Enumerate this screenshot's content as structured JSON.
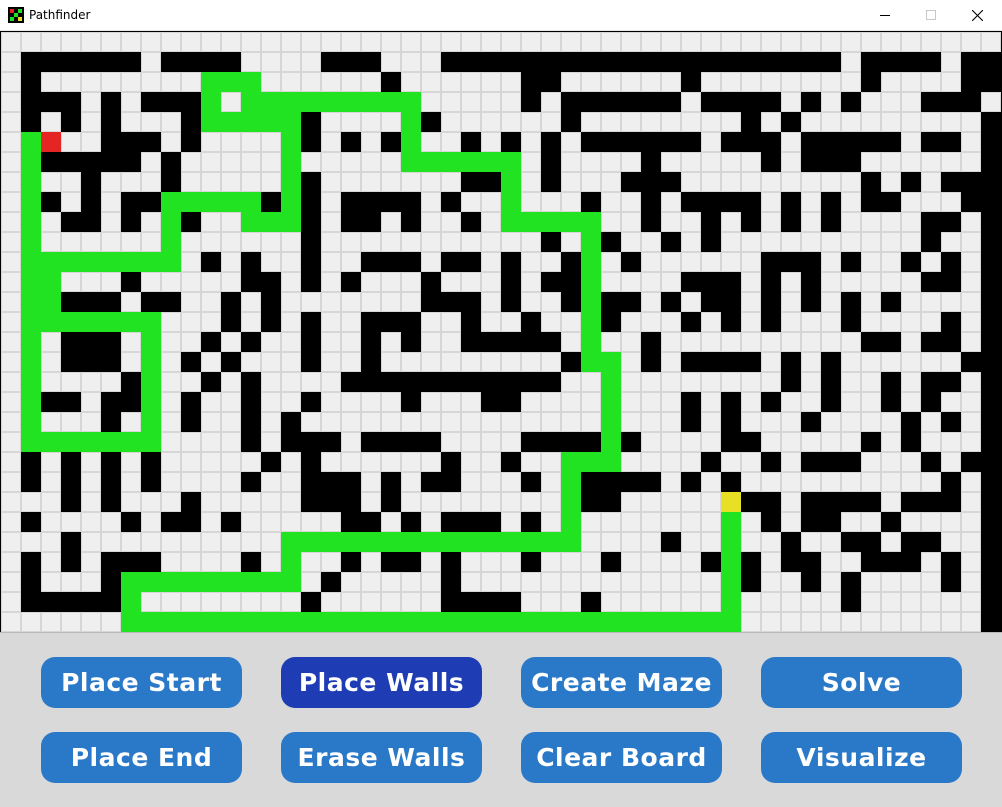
{
  "window": {
    "title": "Pathfinder"
  },
  "colors": {
    "wall": "#000000",
    "open": "#efefef",
    "gridline": "#d6d6d6",
    "path": "#22e322",
    "start": "#e52424",
    "end": "#e8e024",
    "button": "#2a78c8",
    "button_active": "#1e3cb4",
    "panel": "#d9d9d9"
  },
  "maze": {
    "cell_columns": 50,
    "cell_rows": 30,
    "open_rows": [
      "..................................................",
      ".######.####....###...####################.####.##",
      ".#.................#......##......#........#....##",
      ".###.#.###...#.###........#.######.####.#.#...###.",
      ".#.#.#...#.#...#.....#......#........#.#.........#",
      ".#...###.#.....#.#.#...#.#.#.######.###.#####.##.#",
      ".######.#...........#....#.#....#.....#.###......#",
      "....#...#......#.......###.#...###.........#.#.###",
      ".##.#.##..#.##.#.####.#......#..#.####.#.#.##...##",
      ".#.##.#.##.....#.##.#..#.##..#..#..#.#.#.#....##.#",
      ".#......#......#...........#.##..#.#..........#..#",
      ".#.####.#.#.#..#..###.##.#..#..#......###.#..#.#.#",
      "......#.....##.#.#...#...#.##.....###.#.#.....##.#",
      ".#####.##..#.#.......###.#..#.##.#.##.#.#.#.#....#",
      ".#.....#...#.#.#..###..#..#...#...#.#.#...#....#.#",
      ".#.###.#..#.#..#..#.#..#####.#..#..........##.##.#",
      "...###.#.#.#...#..#.........#...#.####.#.#......#",
      ".#....#...#.#....###########...........#.#..#.##.",
      ".###.##..#..#..#....#...##........#.#.#..#..#.#..",
      ".#...#.#.#..#.#...................#.#...#....#.#.",
      "...#...#....#.###.####....######....##.....#.#...",
      ".#.#.#.#.....#.#......#..#.........#..#.###...#.#",
      ".#.#.#.#....#..###.#.##...#.#####.#.#..........#.",
      "...#.#...#.....###.#........###......##.####.###.",
      ".#....#.##.#.....##.#.###.#.........#.#.##..#....",
      "...#..............#.....#........#.....#..##.##..",
      ".#.#.###....#....#.##.#...#...#....#.#.##..###.#.",
      ".#...#...#......#.....#..............#..#.#....#.",
      ".#####.........#......####...#............#......",
      "......................#.........................."
    ],
    "path_cells": [
      [
        2,
        5
      ],
      [
        1,
        5
      ],
      [
        1,
        6
      ],
      [
        1,
        7
      ],
      [
        1,
        8
      ],
      [
        1,
        9
      ],
      [
        1,
        10
      ],
      [
        1,
        11
      ],
      [
        1,
        12
      ],
      [
        1,
        13
      ],
      [
        1,
        14
      ],
      [
        1,
        15
      ],
      [
        1,
        16
      ],
      [
        1,
        17
      ],
      [
        1,
        18
      ],
      [
        1,
        19
      ],
      [
        1,
        20
      ],
      [
        2,
        20
      ],
      [
        3,
        20
      ],
      [
        4,
        20
      ],
      [
        5,
        20
      ],
      [
        6,
        20
      ],
      [
        7,
        20
      ],
      [
        7,
        19
      ],
      [
        7,
        18
      ],
      [
        7,
        17
      ],
      [
        7,
        16
      ],
      [
        7,
        15
      ],
      [
        7,
        14
      ],
      [
        6,
        14
      ],
      [
        5,
        14
      ],
      [
        4,
        14
      ],
      [
        3,
        14
      ],
      [
        2,
        14
      ],
      [
        2,
        13
      ],
      [
        2,
        12
      ],
      [
        2,
        11
      ],
      [
        3,
        11
      ],
      [
        4,
        11
      ],
      [
        5,
        11
      ],
      [
        6,
        11
      ],
      [
        7,
        11
      ],
      [
        8,
        11
      ],
      [
        8,
        10
      ],
      [
        8,
        9
      ],
      [
        8,
        8
      ],
      [
        9,
        8
      ],
      [
        10,
        8
      ],
      [
        11,
        8
      ],
      [
        12,
        8
      ],
      [
        12,
        9
      ],
      [
        13,
        9
      ],
      [
        14,
        9
      ],
      [
        14,
        8
      ],
      [
        14,
        7
      ],
      [
        14,
        6
      ],
      [
        14,
        5
      ],
      [
        14,
        4
      ],
      [
        13,
        4
      ],
      [
        12,
        4
      ],
      [
        11,
        4
      ],
      [
        10,
        4
      ],
      [
        10,
        3
      ],
      [
        10,
        2
      ],
      [
        11,
        2
      ],
      [
        12,
        2
      ],
      [
        12,
        3
      ],
      [
        13,
        3
      ],
      [
        14,
        3
      ],
      [
        15,
        3
      ],
      [
        16,
        3
      ],
      [
        17,
        3
      ],
      [
        18,
        3
      ],
      [
        19,
        3
      ],
      [
        20,
        3
      ],
      [
        20,
        4
      ],
      [
        20,
        5
      ],
      [
        20,
        6
      ],
      [
        21,
        6
      ],
      [
        22,
        6
      ],
      [
        23,
        6
      ],
      [
        24,
        6
      ],
      [
        25,
        6
      ],
      [
        25,
        7
      ],
      [
        25,
        8
      ],
      [
        25,
        9
      ],
      [
        26,
        9
      ],
      [
        27,
        9
      ],
      [
        28,
        9
      ],
      [
        29,
        9
      ],
      [
        29,
        10
      ],
      [
        29,
        11
      ],
      [
        29,
        12
      ],
      [
        29,
        13
      ],
      [
        29,
        14
      ],
      [
        29,
        15
      ],
      [
        29,
        16
      ],
      [
        30,
        16
      ],
      [
        30,
        17
      ],
      [
        30,
        18
      ],
      [
        30,
        19
      ],
      [
        30,
        20
      ],
      [
        30,
        21
      ],
      [
        29,
        21
      ],
      [
        28,
        21
      ],
      [
        28,
        22
      ],
      [
        28,
        23
      ],
      [
        28,
        24
      ],
      [
        28,
        25
      ],
      [
        27,
        25
      ],
      [
        26,
        25
      ],
      [
        25,
        25
      ],
      [
        24,
        25
      ],
      [
        23,
        25
      ],
      [
        22,
        25
      ],
      [
        21,
        25
      ],
      [
        20,
        25
      ],
      [
        19,
        25
      ],
      [
        18,
        25
      ],
      [
        17,
        25
      ],
      [
        16,
        25
      ],
      [
        15,
        25
      ],
      [
        14,
        25
      ],
      [
        14,
        26
      ],
      [
        14,
        27
      ],
      [
        13,
        27
      ],
      [
        12,
        27
      ],
      [
        11,
        27
      ],
      [
        10,
        27
      ],
      [
        9,
        27
      ],
      [
        8,
        27
      ],
      [
        7,
        27
      ],
      [
        6,
        27
      ],
      [
        6,
        28
      ],
      [
        6,
        29
      ],
      [
        7,
        29
      ],
      [
        8,
        29
      ],
      [
        9,
        29
      ],
      [
        10,
        29
      ],
      [
        11,
        29
      ],
      [
        12,
        29
      ],
      [
        13,
        29
      ],
      [
        14,
        29
      ],
      [
        15,
        29
      ],
      [
        16,
        29
      ],
      [
        17,
        29
      ],
      [
        18,
        29
      ],
      [
        19,
        29
      ],
      [
        20,
        29
      ],
      [
        21,
        29
      ],
      [
        22,
        29
      ],
      [
        23,
        29
      ],
      [
        24,
        29
      ],
      [
        25,
        29
      ],
      [
        26,
        29
      ],
      [
        27,
        29
      ],
      [
        28,
        29
      ],
      [
        29,
        29
      ],
      [
        30,
        29
      ],
      [
        31,
        29
      ],
      [
        32,
        29
      ],
      [
        33,
        29
      ],
      [
        34,
        29
      ],
      [
        35,
        29
      ],
      [
        36,
        29
      ],
      [
        36,
        28
      ],
      [
        36,
        27
      ],
      [
        36,
        26
      ],
      [
        36,
        25
      ],
      [
        36,
        24
      ]
    ],
    "start_cell": [
      2,
      5
    ],
    "end_cell": [
      36,
      23
    ]
  },
  "buttons": [
    {
      "id": "place-start",
      "label": "Place Start",
      "active": false
    },
    {
      "id": "place-walls",
      "label": "Place Walls",
      "active": true
    },
    {
      "id": "create-maze",
      "label": "Create Maze",
      "active": false
    },
    {
      "id": "solve",
      "label": "Solve",
      "active": false
    },
    {
      "id": "place-end",
      "label": "Place End",
      "active": false
    },
    {
      "id": "erase-walls",
      "label": "Erase Walls",
      "active": false
    },
    {
      "id": "clear-board",
      "label": "Clear Board",
      "active": false
    },
    {
      "id": "visualize",
      "label": "Visualize",
      "active": false
    }
  ]
}
